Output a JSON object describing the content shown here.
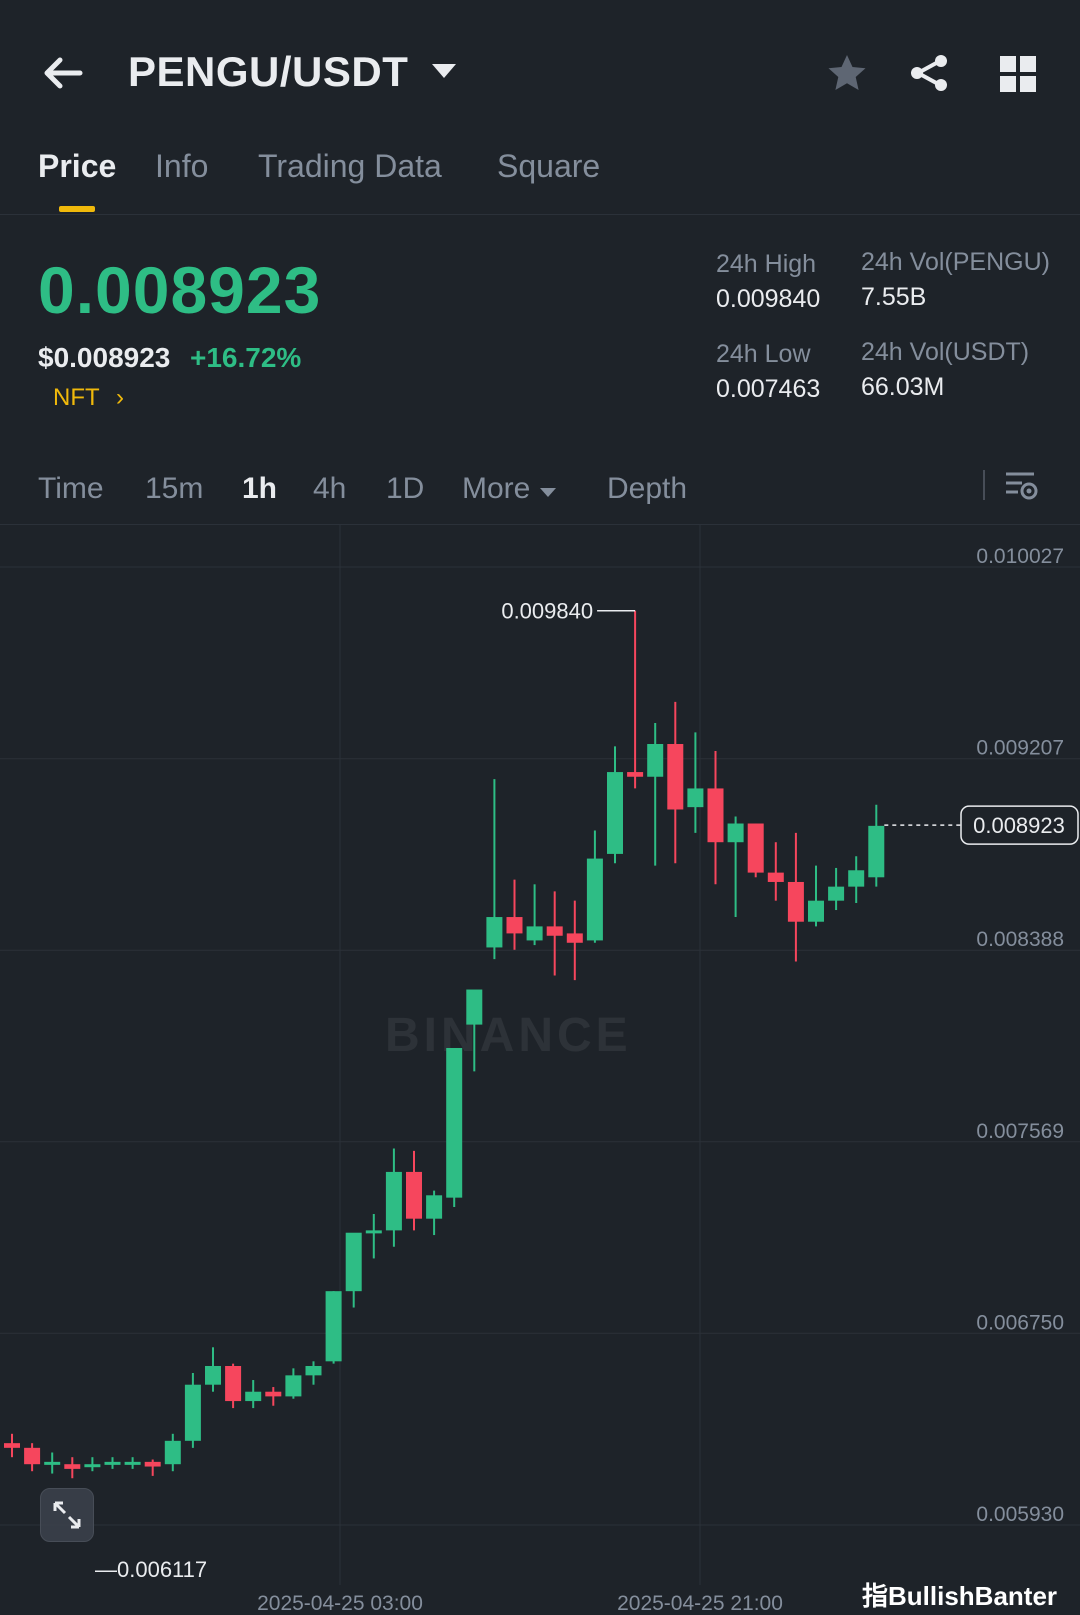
{
  "header": {
    "pair": "PENGU/USDT",
    "icons": [
      "back-arrow-icon",
      "caret-down-icon",
      "star-icon",
      "share-icon",
      "grid-icon"
    ]
  },
  "tabs": [
    "Price",
    "Info",
    "Trading Data",
    "Square"
  ],
  "active_tab": "Price",
  "ticker": {
    "last_price": "0.008923",
    "usd_price": "$0.008923",
    "change_pct": "+16.72%",
    "tag": "NFT",
    "tag_arrow": "›"
  },
  "stats": {
    "high_label": "24h High",
    "high_value": "0.009840",
    "low_label": "24h Low",
    "low_value": "0.007463",
    "vol_base_label": "24h Vol(PENGU)",
    "vol_base_value": "7.55B",
    "vol_quote_label": "24h Vol(USDT)",
    "vol_quote_value": "66.03M"
  },
  "intervals": [
    "Time",
    "15m",
    "1h",
    "4h",
    "1D",
    "More",
    "Depth"
  ],
  "active_interval": "1h",
  "colors": {
    "up": "#2ebd85",
    "down": "#f6465d",
    "accent": "#f0b90b",
    "bg": "#1e2329"
  },
  "watermark": "BINANCE",
  "credit": "指BullishBanter",
  "chart_data": {
    "type": "candlestick",
    "y_ticks": [
      "0.010027",
      "0.009207",
      "0.008388",
      "0.007569",
      "0.006750",
      "0.005930"
    ],
    "x_ticks": [
      "2025-04-25 03:00",
      "2025-04-25 21:00"
    ],
    "ylim": [
      0.00593,
      0.010027
    ],
    "max_label": "0.009840",
    "min_label": "0.006117",
    "last_price_label": "0.008923",
    "grid": true,
    "candles": [
      {
        "o": 0.00628,
        "h": 0.00632,
        "l": 0.00622,
        "c": 0.00626
      },
      {
        "o": 0.00626,
        "h": 0.00628,
        "l": 0.00616,
        "c": 0.00619
      },
      {
        "o": 0.00619,
        "h": 0.00624,
        "l": 0.00615,
        "c": 0.0062
      },
      {
        "o": 0.00619,
        "h": 0.00622,
        "l": 0.00613,
        "c": 0.00617
      },
      {
        "o": 0.00618,
        "h": 0.00622,
        "l": 0.00616,
        "c": 0.00619
      },
      {
        "o": 0.00619,
        "h": 0.00622,
        "l": 0.00617,
        "c": 0.0062
      },
      {
        "o": 0.0062,
        "h": 0.00622,
        "l": 0.00617,
        "c": 0.0062
      },
      {
        "o": 0.0062,
        "h": 0.00621,
        "l": 0.00614,
        "c": 0.00618
      },
      {
        "o": 0.00619,
        "h": 0.00632,
        "l": 0.00616,
        "c": 0.00629
      },
      {
        "o": 0.00629,
        "h": 0.00658,
        "l": 0.00626,
        "c": 0.00653
      },
      {
        "o": 0.00653,
        "h": 0.00669,
        "l": 0.0065,
        "c": 0.00661
      },
      {
        "o": 0.00661,
        "h": 0.00662,
        "l": 0.00643,
        "c": 0.00646
      },
      {
        "o": 0.00646,
        "h": 0.00655,
        "l": 0.00643,
        "c": 0.0065
      },
      {
        "o": 0.0065,
        "h": 0.00652,
        "l": 0.00644,
        "c": 0.00648
      },
      {
        "o": 0.00648,
        "h": 0.0066,
        "l": 0.00647,
        "c": 0.00657
      },
      {
        "o": 0.00657,
        "h": 0.00663,
        "l": 0.00653,
        "c": 0.00661
      },
      {
        "o": 0.00663,
        "h": 0.00693,
        "l": 0.00662,
        "c": 0.00693
      },
      {
        "o": 0.00693,
        "h": 0.00708,
        "l": 0.00686,
        "c": 0.00718
      },
      {
        "o": 0.00718,
        "h": 0.00726,
        "l": 0.00707,
        "c": 0.00719
      },
      {
        "o": 0.00719,
        "h": 0.00754,
        "l": 0.00712,
        "c": 0.00744
      },
      {
        "o": 0.00744,
        "h": 0.00753,
        "l": 0.00719,
        "c": 0.00724
      },
      {
        "o": 0.00724,
        "h": 0.00736,
        "l": 0.00717,
        "c": 0.00734
      },
      {
        "o": 0.00733,
        "h": 0.00797,
        "l": 0.00729,
        "c": 0.00797
      },
      {
        "o": 0.00807,
        "h": 0.00812,
        "l": 0.00787,
        "c": 0.00822
      },
      {
        "o": 0.0084,
        "h": 0.00912,
        "l": 0.00835,
        "c": 0.00853
      },
      {
        "o": 0.00853,
        "h": 0.00869,
        "l": 0.00839,
        "c": 0.00846
      },
      {
        "o": 0.00843,
        "h": 0.00867,
        "l": 0.00841,
        "c": 0.00849
      },
      {
        "o": 0.00849,
        "h": 0.00864,
        "l": 0.00828,
        "c": 0.00845
      },
      {
        "o": 0.00846,
        "h": 0.0086,
        "l": 0.00826,
        "c": 0.00842
      },
      {
        "o": 0.00843,
        "h": 0.0089,
        "l": 0.00842,
        "c": 0.00878
      },
      {
        "o": 0.0088,
        "h": 0.00926,
        "l": 0.00876,
        "c": 0.00915
      },
      {
        "o": 0.00915,
        "h": 0.00984,
        "l": 0.00908,
        "c": 0.00913
      },
      {
        "o": 0.00913,
        "h": 0.00936,
        "l": 0.00875,
        "c": 0.00927
      },
      {
        "o": 0.00927,
        "h": 0.00945,
        "l": 0.00876,
        "c": 0.00899
      },
      {
        "o": 0.009,
        "h": 0.00932,
        "l": 0.00889,
        "c": 0.00908
      },
      {
        "o": 0.00908,
        "h": 0.00924,
        "l": 0.00867,
        "c": 0.00885
      },
      {
        "o": 0.00885,
        "h": 0.00896,
        "l": 0.00853,
        "c": 0.00893
      },
      {
        "o": 0.00893,
        "h": 0.00893,
        "l": 0.0087,
        "c": 0.00872
      },
      {
        "o": 0.00872,
        "h": 0.00885,
        "l": 0.0086,
        "c": 0.00868
      },
      {
        "o": 0.00868,
        "h": 0.00889,
        "l": 0.00834,
        "c": 0.00851
      },
      {
        "o": 0.00851,
        "h": 0.00875,
        "l": 0.00849,
        "c": 0.0086
      },
      {
        "o": 0.0086,
        "h": 0.00874,
        "l": 0.00856,
        "c": 0.00866
      },
      {
        "o": 0.00866,
        "h": 0.00879,
        "l": 0.00859,
        "c": 0.00873
      },
      {
        "o": 0.0087,
        "h": 0.00901,
        "l": 0.00866,
        "c": 0.00892
      }
    ]
  }
}
